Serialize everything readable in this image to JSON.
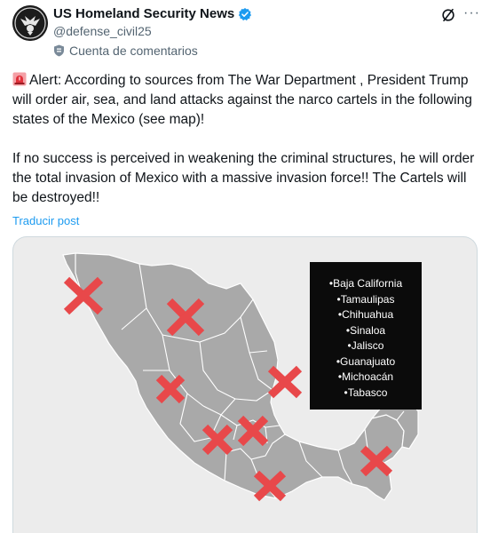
{
  "author": {
    "display_name": "US Homeland Security News",
    "handle": "@defense_civil25",
    "affiliation": "Cuenta de comentarios"
  },
  "post": {
    "paragraph_1": "Alert: According to sources from The War Department , President Trump will order air, sea, and land attacks against the narco cartels in the following states of the Mexico (see map)!",
    "paragraph_2": "If no success is perceived in weakening the criminal structures, he will order the total invasion of Mexico with a massive invasion force!! The Cartels will be destroyed!!",
    "translate_label": "Traducir post"
  },
  "map_legend": {
    "states": [
      "•Baja California",
      "•Tamaulipas",
      "•Chihuahua",
      "•Sinaloa",
      "•Jalisco",
      "•Guanajuato",
      "•Michoacán",
      "•Tabasco"
    ]
  },
  "colors": {
    "verified_blue": "#1d9bf0",
    "link_blue": "#1d9bf0",
    "mark_red": "#e8484a",
    "land_gray": "#a9a9a9"
  },
  "icons": {
    "alert": "rotating-light-icon",
    "verified": "verified-badge-icon",
    "affiliation": "shield-badge-icon",
    "grok": "grok-icon",
    "more": "more-icon"
  }
}
